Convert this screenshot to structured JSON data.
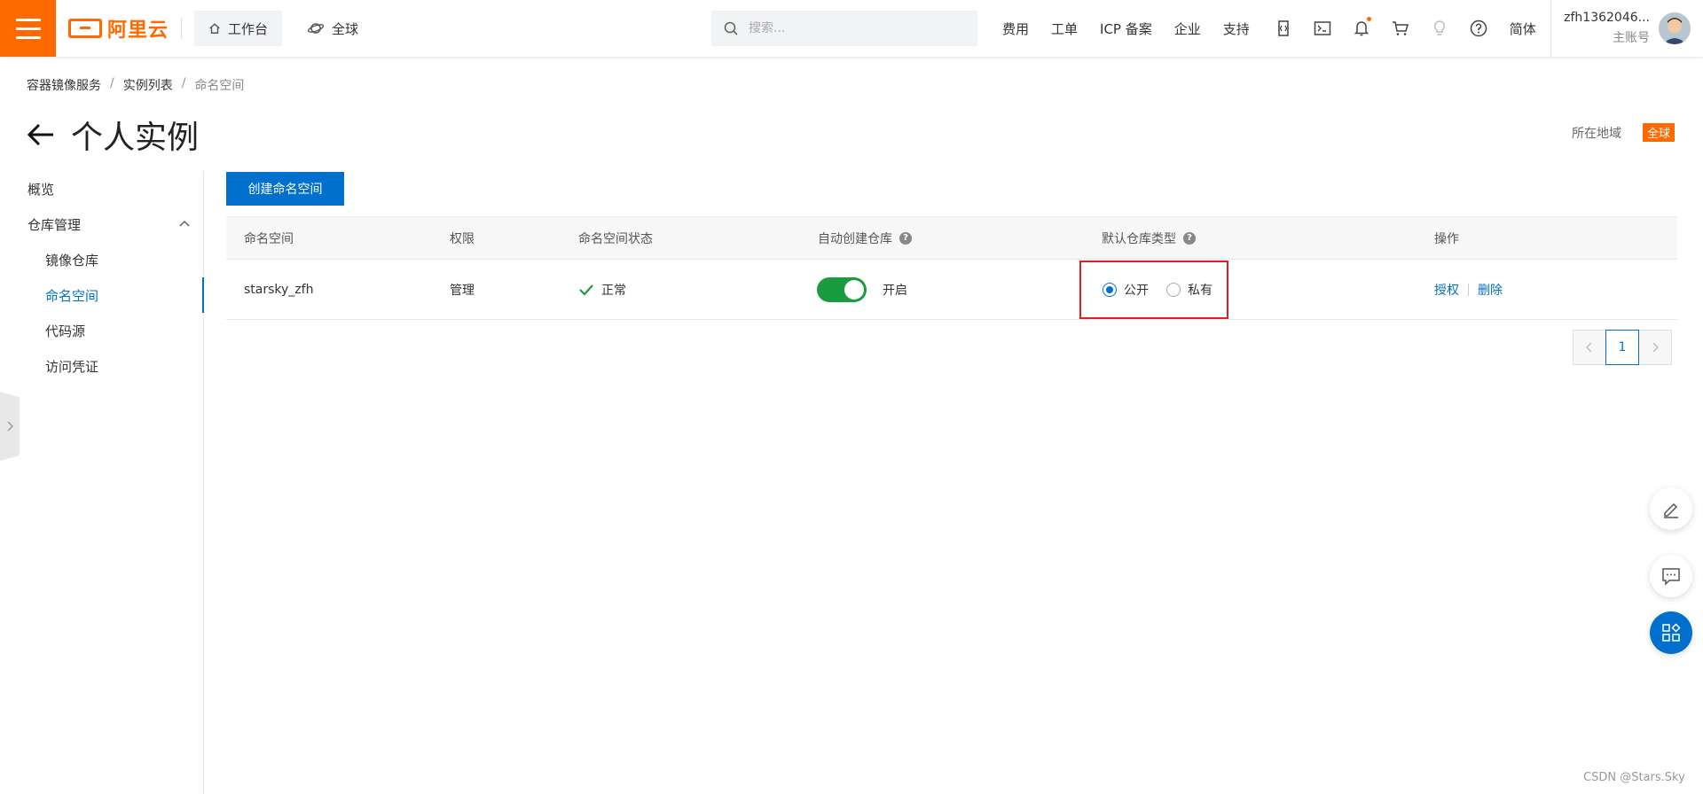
{
  "header": {
    "logo_text": "阿里云",
    "workbench_label": "工作台",
    "region_label": "全球",
    "search_placeholder": "搜索...",
    "nav_links": [
      "费用",
      "工单",
      "ICP 备案",
      "企业",
      "支持"
    ],
    "lang_label": "简体",
    "account_name": "zfh1362046...",
    "account_role": "主账号",
    "brand_color": "#ff6a00"
  },
  "breadcrumb": {
    "items": [
      "容器镜像服务",
      "实例列表",
      "命名空间"
    ]
  },
  "page": {
    "title": "个人实例",
    "region_label": "所在地域",
    "region_value": "全球"
  },
  "sidebar": {
    "items": [
      {
        "label": "概览"
      },
      {
        "label": "仓库管理"
      },
      {
        "label": "镜像仓库"
      },
      {
        "label": "命名空间"
      },
      {
        "label": "代码源"
      },
      {
        "label": "访问凭证"
      }
    ],
    "active_index": 3
  },
  "main": {
    "create_button": "创建命名空间",
    "columns": [
      "命名空间",
      "权限",
      "命名空间状态",
      "自动创建仓库",
      "默认仓库类型",
      "操作"
    ],
    "rows": [
      {
        "namespace": "starsky_zfh",
        "permission": "管理",
        "status": "正常",
        "auto_create": "开启",
        "auto_create_on": true,
        "repo_type_options": [
          "公开",
          "私有"
        ],
        "repo_type_selected": "公开",
        "actions": [
          "授权",
          "删除"
        ]
      }
    ],
    "pagination": {
      "current_page": "1"
    },
    "accent_color": "#0070cc"
  },
  "watermark": "CSDN @Stars.Sky"
}
